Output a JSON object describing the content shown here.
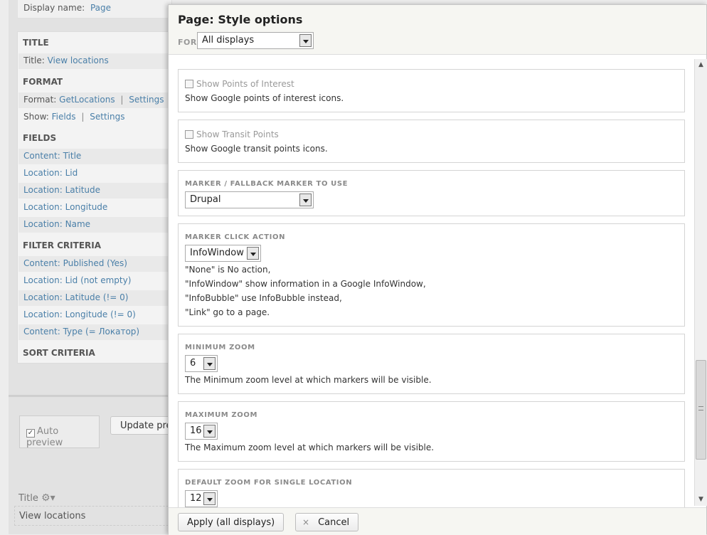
{
  "background": {
    "display_name_label": "Display name:",
    "display_name_value": "Page",
    "title_section": "TITLE",
    "title_label": "Title:",
    "title_value": "View locations",
    "format_section": "FORMAT",
    "format_label": "Format:",
    "format_value": "GetLocations",
    "format_settings": "Settings",
    "show_label": "Show:",
    "show_value": "Fields",
    "show_settings": "Settings",
    "separator": "|",
    "fields_section": "FIELDS",
    "fields": [
      "Content: Title",
      "Location: Lid",
      "Location: Latitude",
      "Location: Longitude",
      "Location: Name"
    ],
    "filter_section": "FILTER CRITERIA",
    "filters": [
      "Content: Published (Yes)",
      "Location: Lid (not empty)",
      "Location: Latitude (!= 0)",
      "Location: Longitude (!= 0)",
      "Content: Type (= Локатор)"
    ],
    "sort_section": "SORT CRITERIA",
    "auto_preview_label": "Auto preview",
    "auto_preview_checked": true,
    "update_preview_label": "Update preview",
    "preview_title_label": "Title",
    "preview_title_value": "View locations"
  },
  "modal": {
    "title": "Page: Style options",
    "for_label": "FOR",
    "for_select": "All displays",
    "poi_checkbox": "Show Points of Interest",
    "poi_desc": "Show Google points of interest icons.",
    "transit_checkbox": "Show Transit Points",
    "transit_desc": "Show Google transit points icons.",
    "marker_caption": "MARKER / FALLBACK MARKER TO USE",
    "marker_select": "Drupal",
    "click_caption": "MARKER CLICK ACTION",
    "click_select": "InfoWindow",
    "click_desc": [
      "\"None\" is No action,",
      "\"InfoWindow\" show information in a Google InfoWindow,",
      "\"InfoBubble\" use InfoBubble instead,",
      "\"Link\" go to a page."
    ],
    "minzoom_caption": "MINIMUM ZOOM",
    "minzoom_select": "6",
    "minzoom_desc": "The Minimum zoom level at which markers will be visible.",
    "maxzoom_caption": "MAXIMUM ZOOM",
    "maxzoom_select": "16",
    "maxzoom_desc": "The Maximum zoom level at which markers will be visible.",
    "defzoom_caption": "DEFAULT ZOOM FOR SINGLE LOCATION",
    "defzoom_select": "12",
    "apply_button": "Apply (all displays)",
    "cancel_button": "Cancel",
    "cancel_icon": "×",
    "scroll_position": 0.72
  },
  "colors": {
    "link": "#4a7fa8",
    "modal_header_bg": "#f6f6f2"
  }
}
